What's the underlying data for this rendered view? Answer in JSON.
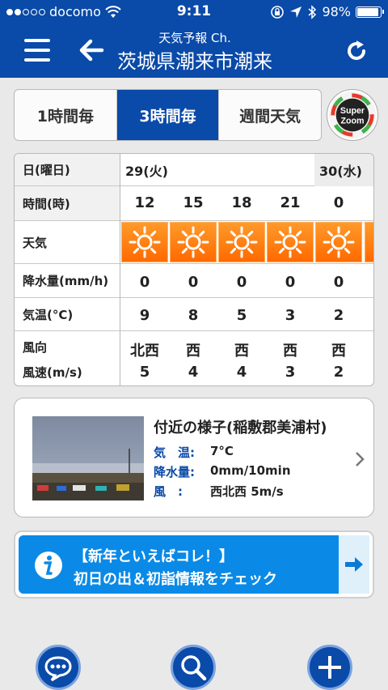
{
  "status_bar": {
    "carrier": "docomo",
    "time": "9:11",
    "battery": "98%",
    "battery_level": 0.98,
    "signal_bars_filled": 2,
    "signal_bars_total": 5
  },
  "header": {
    "subtitle": "天気予報 Ch.",
    "title": "茨城県潮来市潮来"
  },
  "tabs": [
    {
      "label": "1時間毎",
      "active": false
    },
    {
      "label": "3時間毎",
      "active": true
    },
    {
      "label": "週間天気",
      "active": false
    }
  ],
  "super_zoom": {
    "line1": "Super",
    "line2": "Zoom"
  },
  "forecast": {
    "row_labels": {
      "day": "日(曜日)",
      "time": "時間(時)",
      "weather": "天気",
      "precip": "降水量(mm/h)",
      "temp": "気温(°C)",
      "wind_dir": "風向",
      "wind_speed": "風速(m/s)"
    },
    "dates": [
      "29(火)",
      "30(水)"
    ],
    "columns": [
      {
        "hour": "12",
        "weather": "sunny-icon",
        "precip": "0",
        "temp": "9",
        "wind_dir": "北西",
        "wind_speed": "5"
      },
      {
        "hour": "15",
        "weather": "sunny-icon",
        "precip": "0",
        "temp": "8",
        "wind_dir": "西",
        "wind_speed": "4"
      },
      {
        "hour": "18",
        "weather": "sunny-icon",
        "precip": "0",
        "temp": "5",
        "wind_dir": "西",
        "wind_speed": "4"
      },
      {
        "hour": "21",
        "weather": "sunny-icon",
        "precip": "0",
        "temp": "3",
        "wind_dir": "西",
        "wind_speed": "3"
      },
      {
        "hour": "0",
        "weather": "sunny-icon",
        "precip": "0",
        "temp": "2",
        "wind_dir": "西",
        "wind_speed": "2"
      }
    ]
  },
  "nearby": {
    "title": "付近の様子(稲敷郡美浦村)",
    "rows": [
      {
        "key": "気　温:",
        "value": "7°C"
      },
      {
        "key": "降水量:",
        "value": "0mm/10min"
      },
      {
        "key": "風　:",
        "value": "西北西 5m/s"
      }
    ]
  },
  "banner": {
    "line1": "【新年といえばコレ！】",
    "line2": "初日の出＆初詣情報をチェック"
  },
  "bottom_actions": [
    "chat-icon",
    "search-icon",
    "plus-icon"
  ],
  "colors": {
    "brand": "#0a4aa8",
    "sunny": "#ff7a00",
    "banner": "#0a8ae6",
    "label_blue": "#0a4aa8"
  }
}
